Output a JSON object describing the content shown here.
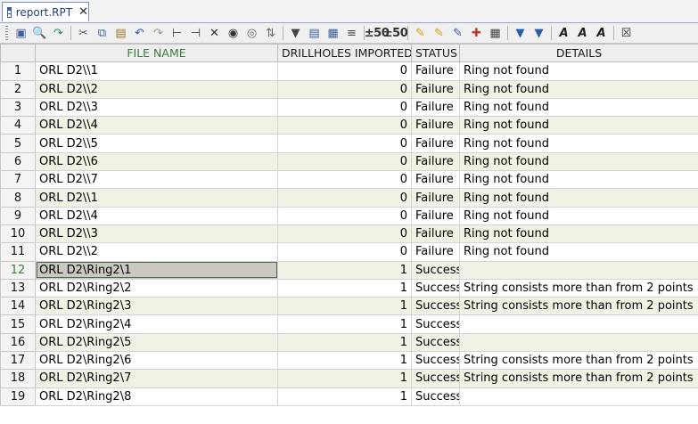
{
  "tab": {
    "title": "report.RPT",
    "close": "✕"
  },
  "toolbar": {
    "text1": "±50",
    "text2": "±50"
  },
  "table": {
    "headers": [
      "",
      "FILE NAME",
      "DRILLHOLES IMPORTED",
      "STATUS",
      "DETAILS"
    ],
    "rows": [
      [
        "1",
        "ORL D2\\\\1",
        "0",
        "Failure",
        "Ring not found"
      ],
      [
        "2",
        "ORL D2\\\\2",
        "0",
        "Failure",
        "Ring not found"
      ],
      [
        "3",
        "ORL D2\\\\3",
        "0",
        "Failure",
        "Ring not found"
      ],
      [
        "4",
        "ORL D2\\\\4",
        "0",
        "Failure",
        "Ring not found"
      ],
      [
        "5",
        "ORL D2\\\\5",
        "0",
        "Failure",
        "Ring not found"
      ],
      [
        "6",
        "ORL D2\\\\6",
        "0",
        "Failure",
        "Ring not found"
      ],
      [
        "7",
        "ORL D2\\\\7",
        "0",
        "Failure",
        "Ring not found"
      ],
      [
        "8",
        "ORL D2\\\\1",
        "0",
        "Failure",
        "Ring not found"
      ],
      [
        "9",
        "ORL D2\\\\4",
        "0",
        "Failure",
        "Ring not found"
      ],
      [
        "10",
        "ORL D2\\\\3",
        "0",
        "Failure",
        "Ring not found"
      ],
      [
        "11",
        "ORL D2\\\\2",
        "0",
        "Failure",
        "Ring not found"
      ],
      [
        "12",
        "ORL D2\\Ring2\\1",
        "1",
        "Success",
        ""
      ],
      [
        "13",
        "ORL D2\\Ring2\\2",
        "1",
        "Success",
        "String consists more than from 2 points"
      ],
      [
        "14",
        "ORL D2\\Ring2\\3",
        "1",
        "Success",
        "String consists more than from 2 points"
      ],
      [
        "15",
        "ORL D2\\Ring2\\4",
        "1",
        "Success",
        ""
      ],
      [
        "16",
        "ORL D2\\Ring2\\5",
        "1",
        "Success",
        ""
      ],
      [
        "17",
        "ORL D2\\Ring2\\6",
        "1",
        "Success",
        "String consists more than from 2 points"
      ],
      [
        "18",
        "ORL D2\\Ring2\\7",
        "1",
        "Success",
        "String consists more than from 2 points"
      ],
      [
        "19",
        "ORL D2\\Ring2\\8",
        "1",
        "Success",
        ""
      ]
    ]
  }
}
